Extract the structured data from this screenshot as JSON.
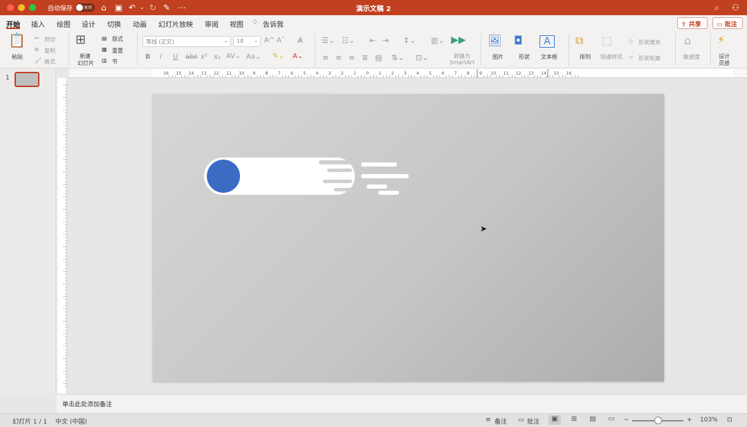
{
  "titlebar": {
    "autosave_label": "自动保存",
    "autosave_state": "关闭",
    "doc_title": "演示文稿 2",
    "icons": [
      "home-icon",
      "save-icon",
      "undo-icon",
      "redo-icon",
      "edit-icon",
      "more-icon",
      "search-icon",
      "share-person-icon"
    ]
  },
  "tabs": [
    "开始",
    "插入",
    "绘图",
    "设计",
    "切换",
    "动画",
    "幻灯片放映",
    "审阅",
    "视图"
  ],
  "tell_me": "告诉我",
  "share_label": "共享",
  "comment_label": "批注",
  "ribbon": {
    "paste": "粘贴",
    "cut": "剪切",
    "copy": "复制",
    "format": "格式",
    "new_slide_line1": "新建",
    "new_slide_line2": "幻灯片",
    "layout": "版式",
    "reset": "重置",
    "section": "节",
    "font_name": "等线 (正文)",
    "font_size": "18",
    "convert_line1": "转换为",
    "convert_line2": "SmartArt",
    "picture": "图片",
    "shape": "形状",
    "textbox": "文本框",
    "arrange": "排列",
    "quick_styles": "快速样式",
    "shape_fill": "形状填充",
    "shape_outline": "形状轮廓",
    "sensitivity": "敏感度",
    "designer_line1": "设计",
    "designer_line2": "灵感"
  },
  "ruler_labels": [
    "16",
    "15",
    "14",
    "13",
    "12",
    "11",
    "10",
    "9",
    "8",
    "7",
    "6",
    "5",
    "4",
    "3",
    "2",
    "1",
    "0",
    "1",
    "2",
    "3",
    "4",
    "5",
    "6",
    "7",
    "8",
    "9",
    "10",
    "11",
    "12",
    "13",
    "14",
    "15",
    "16"
  ],
  "slide_panel": {
    "number": "1"
  },
  "notes_placeholder": "单击此处添加备注",
  "status": {
    "slide_count": "幻灯片 1 / 1",
    "language": "中文 (中国)",
    "notes": "备注",
    "comments": "批注",
    "zoom": "103%"
  },
  "colors": {
    "accent": "#c1401f",
    "circle": "#3b6cc4",
    "slide_bg_start": "#d6d6d6",
    "slide_bg_end": "#aeabab"
  }
}
